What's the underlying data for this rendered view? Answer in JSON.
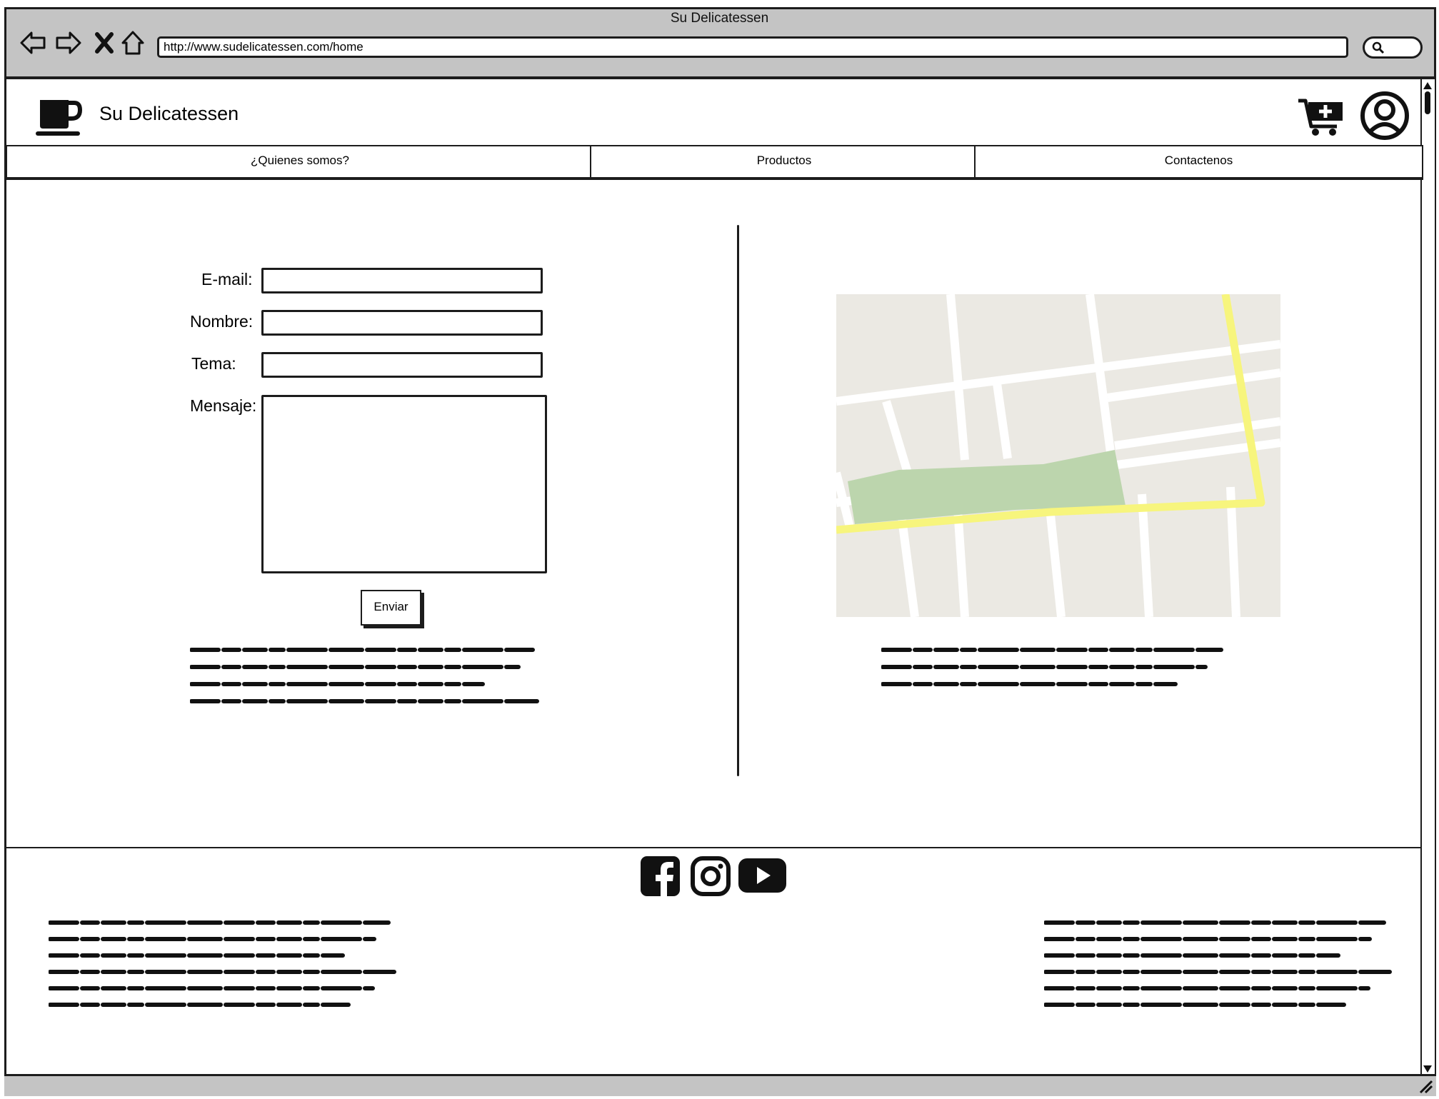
{
  "browser": {
    "window_title": "Su Delicatessen",
    "url": "http://www.sudelicatessen.com/home"
  },
  "header": {
    "site_title": "Su Delicatessen"
  },
  "nav": {
    "tabs": [
      {
        "label": "¿Quienes somos?"
      },
      {
        "label": "Productos"
      },
      {
        "label": "Contactenos"
      }
    ]
  },
  "form": {
    "email_label": "E-mail:",
    "nombre_label": "Nombre:",
    "tema_label": "Tema:",
    "mensaje_label": "Mensaje:",
    "email_value": "",
    "nombre_value": "",
    "tema_value": "",
    "mensaje_value": "",
    "submit_label": "Enviar"
  },
  "colors": {
    "chrome_gray": "#c4c4c4",
    "ink": "#1c1c1c",
    "map_land": "#ebe9e3",
    "map_park": "#bcd5ad",
    "map_highway": "#f7f57d"
  },
  "icons": {
    "back": "arrow-left-icon",
    "forward": "arrow-right-icon",
    "stop": "close-icon",
    "home": "home-icon",
    "search": "search-icon",
    "logo": "coffee-cup-icon",
    "cart": "add-to-cart-icon",
    "user": "user-circle-icon",
    "facebook": "facebook-icon",
    "instagram": "instagram-icon",
    "youtube": "youtube-icon"
  }
}
